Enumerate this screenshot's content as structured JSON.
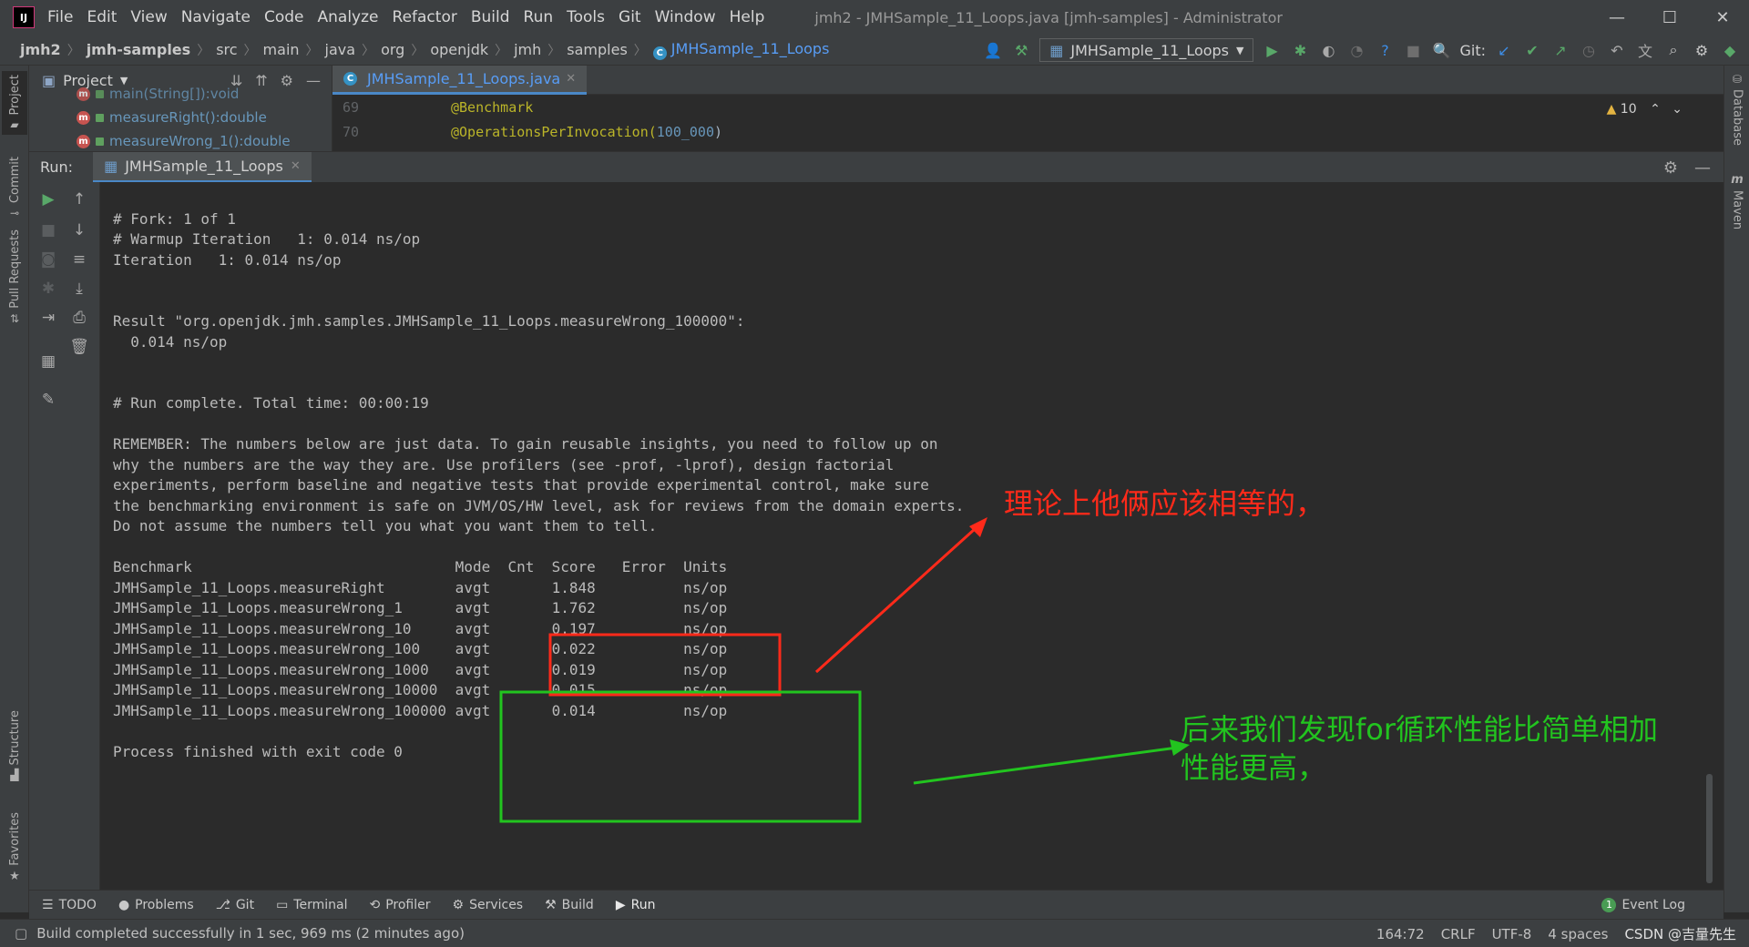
{
  "app": {
    "logo_text": "IJ",
    "window_title": "jmh2 - JMHSample_11_Loops.java [jmh-samples] - Administrator",
    "window_controls": [
      "—",
      "☐",
      "✕"
    ]
  },
  "menu": [
    "File",
    "Edit",
    "View",
    "Navigate",
    "Code",
    "Analyze",
    "Refactor",
    "Build",
    "Run",
    "Tools",
    "Git",
    "Window",
    "Help"
  ],
  "breadcrumbs": [
    "jmh2",
    "jmh-samples",
    "src",
    "main",
    "java",
    "org",
    "openjdk",
    "jmh",
    "samples"
  ],
  "breadcrumb_file": "JMHSample_11_Loops",
  "toolbar": {
    "run_config": "JMHSample_11_Loops",
    "git_label": "Git:"
  },
  "left_tabs": [
    "Project",
    "Commit",
    "Pull Requests",
    "Structure",
    "Favorites"
  ],
  "right_tabs": [
    "Database",
    "Maven"
  ],
  "project_panel": {
    "title": "Project",
    "items": [
      {
        "label": "main(String[]):void",
        "icon": "m"
      },
      {
        "label": "measureRight():double",
        "icon": "m"
      },
      {
        "label": "measureWrong_1():double",
        "icon": "m"
      }
    ]
  },
  "editor": {
    "tab_label": "JMHSample_11_Loops.java",
    "lines": [
      {
        "num": "69",
        "annotation": "@Benchmark",
        "arg": ""
      },
      {
        "num": "70",
        "annotation": "@OperationsPerInvocation(",
        "arg": "100_000",
        "close": ")"
      }
    ],
    "warnings": "10"
  },
  "run_panel": {
    "label": "Run:",
    "tab_label": "JMHSample_11_Loops"
  },
  "console": {
    "lines": [
      "# Fork: 1 of 1",
      "# Warmup Iteration   1: 0.014 ns/op",
      "Iteration   1: 0.014 ns/op",
      "",
      "",
      "Result \"org.openjdk.jmh.samples.JMHSample_11_Loops.measureWrong_100000\":",
      "  0.014 ns/op",
      "",
      "",
      "# Run complete. Total time: 00:00:19",
      "",
      "REMEMBER: The numbers below are just data. To gain reusable insights, you need to follow up on",
      "why the numbers are the way they are. Use profilers (see -prof, -lprof), design factorial",
      "experiments, perform baseline and negative tests that provide experimental control, make sure",
      "the benchmarking environment is safe on JVM/OS/HW level, ask for reviews from the domain experts.",
      "Do not assume the numbers tell you what you want them to tell.",
      "",
      "Benchmark                              Mode  Cnt  Score   Error  Units",
      "JMHSample_11_Loops.measureRight        avgt       1.848          ns/op",
      "JMHSample_11_Loops.measureWrong_1      avgt       1.762          ns/op",
      "JMHSample_11_Loops.measureWrong_10     avgt       0.197          ns/op",
      "JMHSample_11_Loops.measureWrong_100    avgt       0.022          ns/op",
      "JMHSample_11_Loops.measureWrong_1000   avgt       0.019          ns/op",
      "JMHSample_11_Loops.measureWrong_10000  avgt       0.015          ns/op",
      "JMHSample_11_Loops.measureWrong_100000 avgt       0.014          ns/op",
      "",
      "Process finished with exit code 0"
    ]
  },
  "annotations": {
    "red_note": "理论上他俩应该相等的，",
    "green_note_1": "后来我们发现for循环性能比简单相加",
    "green_note_2": "性能更高，",
    "red_color": "#ff2a1a",
    "green_color": "#22c41f"
  },
  "bottom_tabs": [
    {
      "label": "TODO",
      "icon": "list-icon"
    },
    {
      "label": "Problems",
      "icon": "problems-icon"
    },
    {
      "label": "Git",
      "icon": "git-icon"
    },
    {
      "label": "Terminal",
      "icon": "terminal-icon"
    },
    {
      "label": "Profiler",
      "icon": "profiler-icon"
    },
    {
      "label": "Services",
      "icon": "services-icon"
    },
    {
      "label": "Build",
      "icon": "hammer-icon"
    },
    {
      "label": "Run",
      "icon": "play-icon"
    }
  ],
  "event_log": {
    "label": "Event Log",
    "count": "1"
  },
  "status": {
    "message": "Build completed successfully in 1 sec, 969 ms (2 minutes ago)",
    "position": "164:72",
    "line_sep": "CRLF",
    "encoding": "UTF-8",
    "indent": "4 spaces",
    "watermark": "CSDN @吉量先生"
  }
}
